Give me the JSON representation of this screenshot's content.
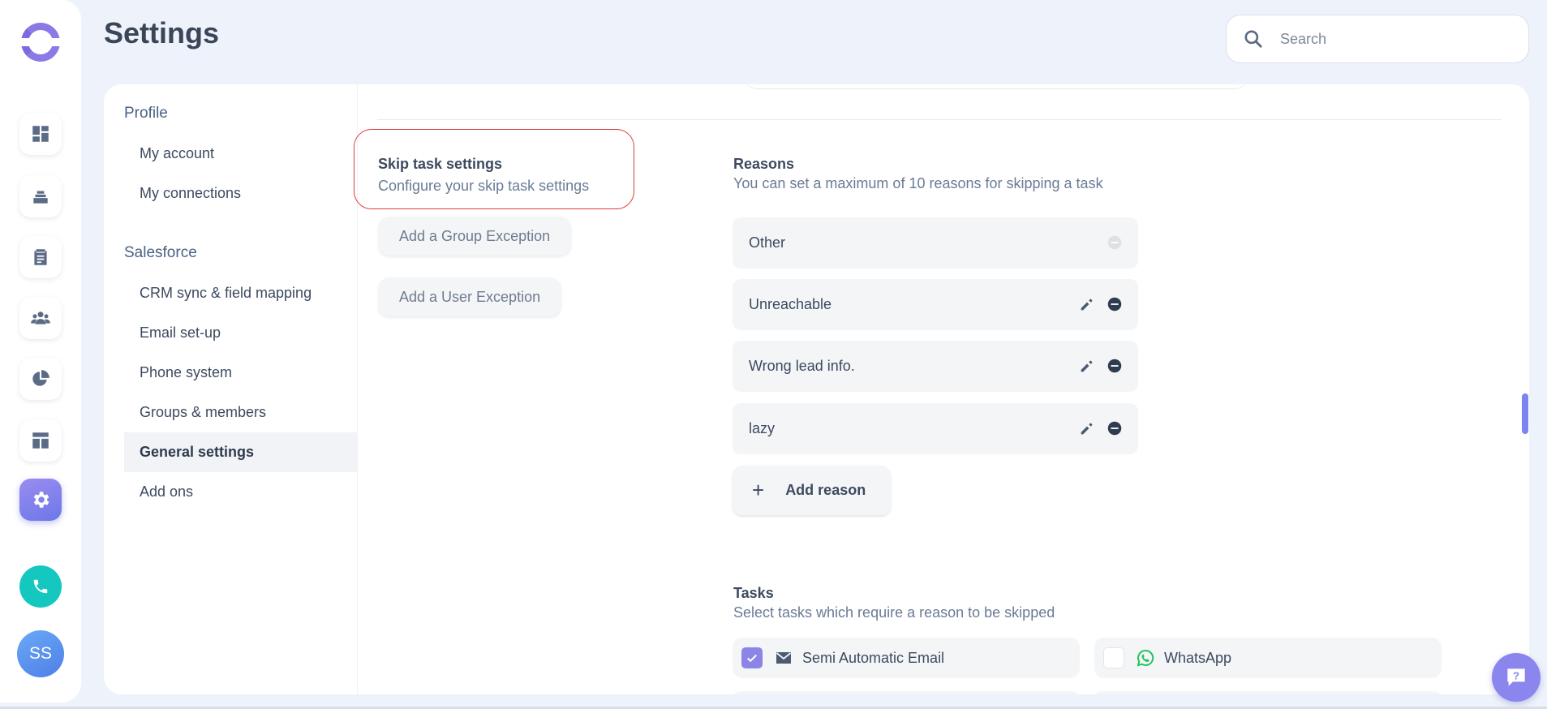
{
  "app": {
    "logo": "app-logo"
  },
  "rail": {
    "items": [
      {
        "icon": "dashboard-icon"
      },
      {
        "icon": "layers-icon"
      },
      {
        "icon": "clipboard-icon"
      },
      {
        "icon": "people-icon"
      },
      {
        "icon": "pie-chart-icon"
      },
      {
        "icon": "layout-icon"
      },
      {
        "icon": "gear-icon",
        "active": true
      }
    ],
    "call_icon": "phone-icon",
    "avatar_initials": "SS"
  },
  "header": {
    "title": "Settings",
    "search_placeholder": "Search"
  },
  "sidebar": {
    "profile_title": "Profile",
    "profile_items": [
      "My account",
      "My connections"
    ],
    "salesforce_title": "Salesforce",
    "salesforce_items": [
      "CRM sync & field mapping",
      "Email set-up",
      "Phone system",
      "Groups & members",
      "General settings",
      "Add ons"
    ],
    "active": "General settings"
  },
  "skip": {
    "title": "Skip task settings",
    "subtitle": "Configure your skip task settings",
    "group_exception": "Add a Group Exception",
    "user_exception": "Add a User Exception"
  },
  "reasons": {
    "title": "Reasons",
    "subtitle": "You can set a maximum of 10 reasons for skipping a task",
    "items": [
      {
        "label": "Other",
        "editable": false
      },
      {
        "label": "Unreachable",
        "editable": true
      },
      {
        "label": "Wrong lead info.",
        "editable": true
      },
      {
        "label": "lazy",
        "editable": true
      }
    ],
    "add_label": "Add reason"
  },
  "tasks": {
    "title": "Tasks",
    "subtitle": "Select tasks which require a reason to be skipped",
    "items": [
      {
        "label": "Semi Automatic Email",
        "checked": true,
        "icon": "mail-icon"
      },
      {
        "label": "WhatsApp",
        "checked": false,
        "icon": "whatsapp-icon"
      }
    ]
  },
  "colors": {
    "accent": "#8a86ee",
    "highlight_border": "#e03a3a",
    "call": "#14c8c0"
  }
}
